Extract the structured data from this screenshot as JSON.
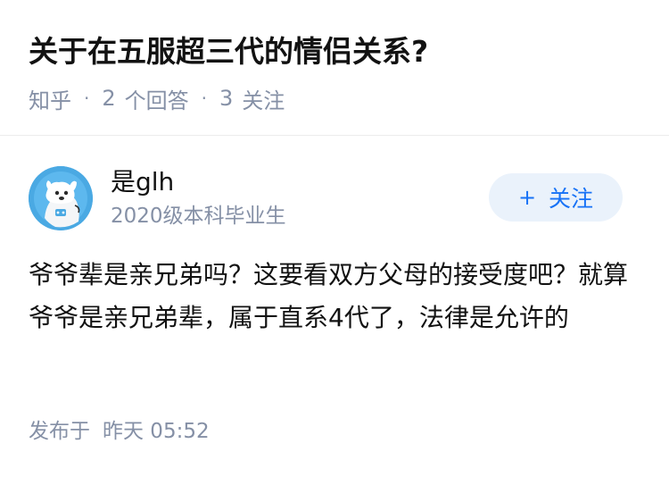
{
  "question": {
    "title": "关于在五服超三代的情侣关系?",
    "source": "知乎",
    "answer_count": "2",
    "answer_label": "个回答",
    "follow_count": "3",
    "follow_label": "关注"
  },
  "author": {
    "avatar": "avatar-illustration-icon",
    "name": "是glh",
    "bio": "2020级本科毕业生",
    "follow_button_label": "关注",
    "follow_button_icon": "plus-icon"
  },
  "answer": {
    "paragraphs": [
      "爷爷辈是亲兄弟吗？这要看双方父母的接受度吧？就算爷爷是亲兄弟辈，属于直系4代了，法律是允许的"
    ]
  },
  "footer": {
    "publish_prefix": "发布于",
    "publish_time": "昨天 05:52"
  },
  "colors": {
    "text": "#121212",
    "muted": "#8590a6",
    "accent": "#1772f6",
    "button_bg": "#eaf2fb",
    "avatar_bg": "#4aa9e3"
  }
}
